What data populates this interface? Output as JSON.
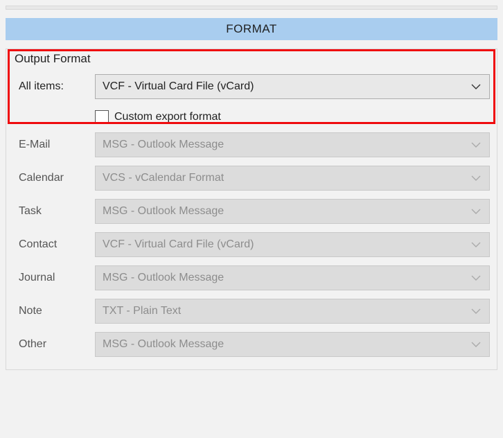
{
  "section_header": "FORMAT",
  "group_title": "Output Format",
  "all_items": {
    "label": "All items:",
    "value": "VCF - Virtual Card File (vCard)"
  },
  "custom_export": {
    "label": "Custom export format",
    "checked": false
  },
  "rows": {
    "email": {
      "label": "E-Mail",
      "value": "MSG - Outlook Message"
    },
    "calendar": {
      "label": "Calendar",
      "value": "VCS - vCalendar Format"
    },
    "task": {
      "label": "Task",
      "value": "MSG - Outlook Message"
    },
    "contact": {
      "label": "Contact",
      "value": "VCF - Virtual Card File (vCard)"
    },
    "journal": {
      "label": "Journal",
      "value": "MSG - Outlook Message"
    },
    "note": {
      "label": "Note",
      "value": "TXT - Plain Text"
    },
    "other": {
      "label": "Other",
      "value": "MSG - Outlook Message"
    }
  }
}
